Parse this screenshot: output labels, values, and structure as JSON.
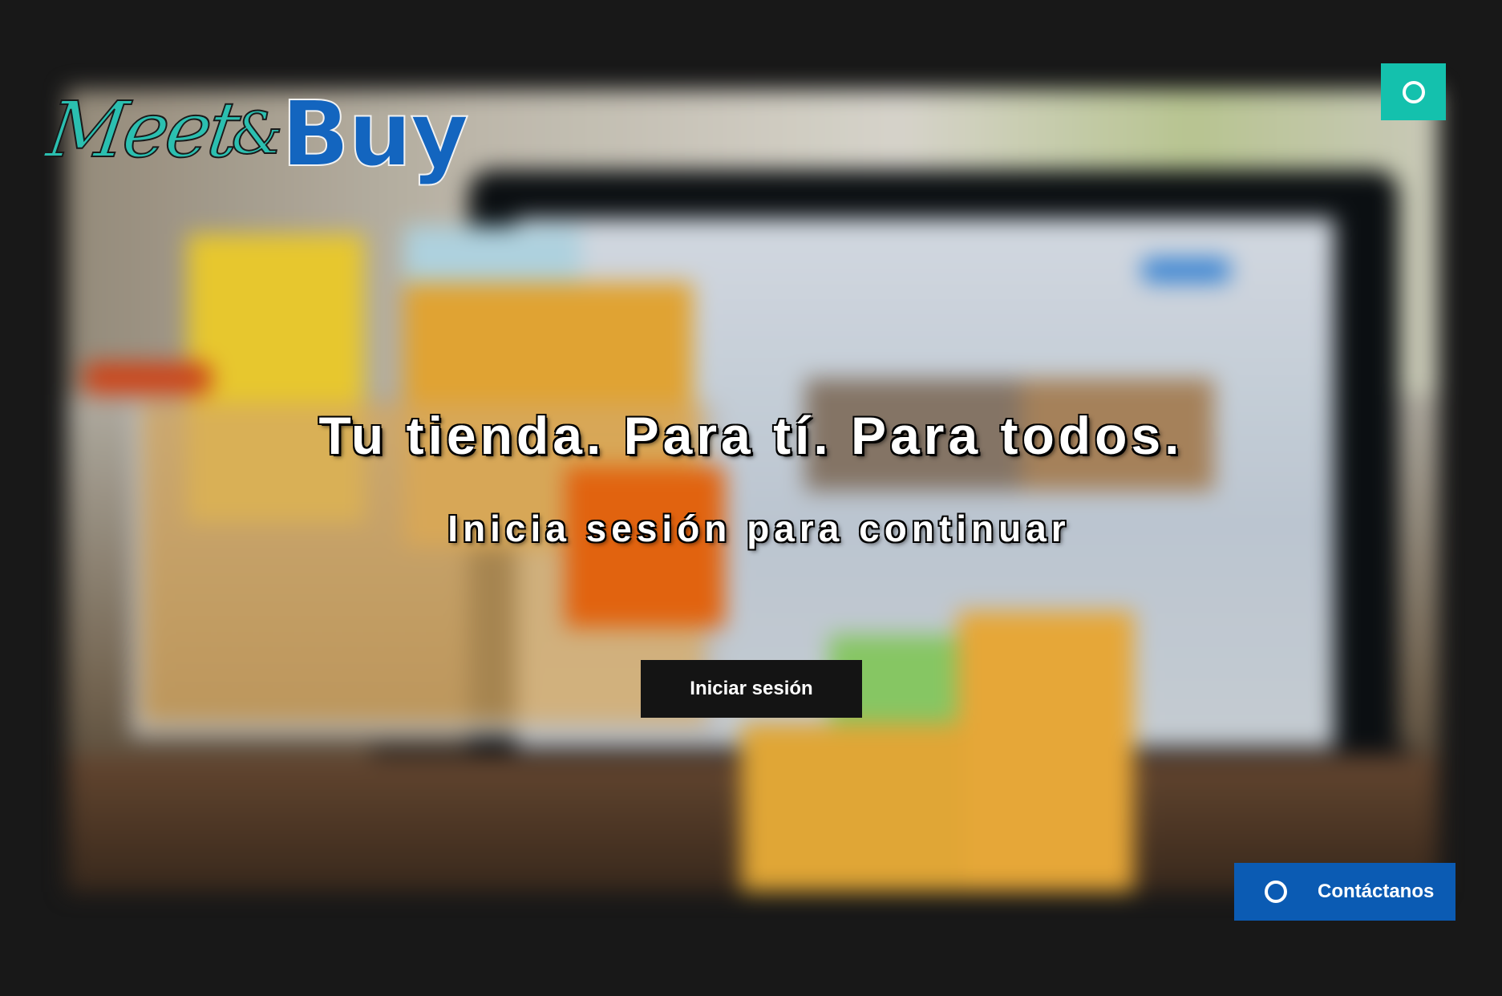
{
  "brand": {
    "logo_part1": "Meet",
    "logo_amp": "&",
    "logo_part2": "Buy",
    "teal": "#14c1ad",
    "blue": "#1365bf"
  },
  "header": {
    "menu_button_icon": "circle-icon"
  },
  "hero": {
    "headline": "Tu tienda. Para tí. Para todos.",
    "subheadline": "Inicia sesión para continuar",
    "login_button": "Iniciar sesión",
    "background_image": "shopping-cart-with-bags-and-laptop"
  },
  "contact": {
    "label": "Contáctanos",
    "icon": "circle-icon",
    "color": "#0b5bb3"
  },
  "colors": {
    "page_background": "#181818",
    "login_button_bg": "#141414"
  }
}
